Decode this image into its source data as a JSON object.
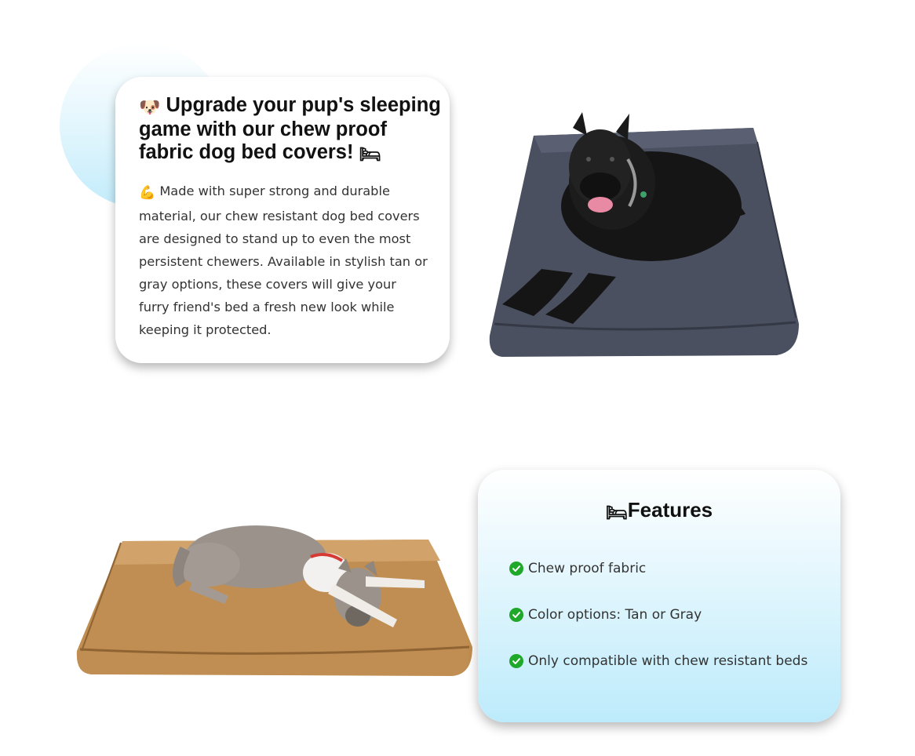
{
  "intro": {
    "title_emoji_start": "🐶",
    "title": "Upgrade your pup's sleeping game with our chew proof fabric dog bed covers!",
    "title_emoji_end": "🛏",
    "body_emoji": "💪",
    "body": "Made with super strong and durable material, our chew resistant dog bed covers are designed to stand up to even the most persistent chewers. Available in stylish tan or gray options, these covers will give your furry friend's bed a fresh new look while keeping it protected."
  },
  "features": {
    "title_emoji": "🛏",
    "title": "Features",
    "items": [
      "Chew proof fabric",
      "Color options: Tan or Gray",
      "Only compatible with chew resistant beds"
    ]
  },
  "icons": {
    "check": "check-circle-icon"
  },
  "colors": {
    "check": "#1fa82a",
    "gray_bed": "#4a5060",
    "tan_bed": "#c08e52"
  }
}
